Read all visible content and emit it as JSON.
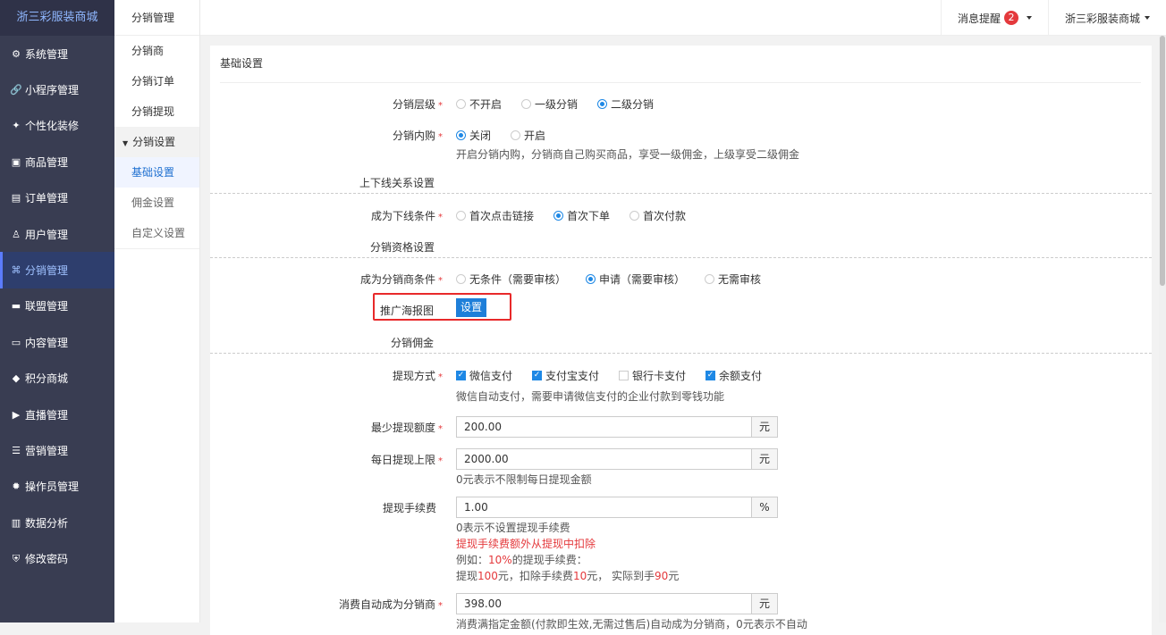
{
  "brand": "浙三彩服装商城",
  "sidebar": {
    "items": [
      {
        "label": "系统管理",
        "icon": "gear-icon"
      },
      {
        "label": "小程序管理",
        "icon": "link-icon"
      },
      {
        "label": "个性化装修",
        "icon": "brush-icon"
      },
      {
        "label": "商品管理",
        "icon": "bag-icon"
      },
      {
        "label": "订单管理",
        "icon": "clipboard-icon"
      },
      {
        "label": "用户管理",
        "icon": "user-icon"
      },
      {
        "label": "分销管理",
        "icon": "share-icon"
      },
      {
        "label": "联盟管理",
        "icon": "store-icon"
      },
      {
        "label": "内容管理",
        "icon": "content-icon"
      },
      {
        "label": "积分商城",
        "icon": "cube-icon"
      },
      {
        "label": "直播管理",
        "icon": "play-icon"
      },
      {
        "label": "营销管理",
        "icon": "marketing-icon"
      },
      {
        "label": "操作员管理",
        "icon": "cog-icon"
      },
      {
        "label": "数据分析",
        "icon": "chart-icon"
      },
      {
        "label": "修改密码",
        "icon": "shield-icon"
      }
    ],
    "active": "分销管理"
  },
  "submenu": {
    "title": "分销管理",
    "items": [
      "分销商",
      "分销订单",
      "分销提现"
    ],
    "group": "分销设置",
    "group_items": [
      "基础设置",
      "佣金设置",
      "自定义设置"
    ],
    "active": "基础设置"
  },
  "topbar": {
    "messages": "消息提醒",
    "badge": "2",
    "account": "浙三彩服装商城"
  },
  "panel": {
    "title": "基础设置"
  },
  "form": {
    "level": {
      "label": "分销层级",
      "options": [
        "不开启",
        "一级分销",
        "二级分销"
      ],
      "selected": "二级分销"
    },
    "inner": {
      "label": "分销内购",
      "options": [
        "关闭",
        "开启"
      ],
      "selected": "关闭",
      "hint": "开启分销内购，分销商自己购买商品，享受一级佣金，上级享受二级佣金"
    },
    "relation_section": "上下线关系设置",
    "downline": {
      "label": "成为下线条件",
      "options": [
        "首次点击链接",
        "首次下单",
        "首次付款"
      ],
      "selected": "首次下单"
    },
    "qual_section": "分销资格设置",
    "qual": {
      "label": "成为分销商条件",
      "options": [
        "无条件（需要审核）",
        "申请（需要审核）",
        "无需审核"
      ],
      "selected": "申请（需要审核）"
    },
    "poster": {
      "label": "推广海报图",
      "button": "设置"
    },
    "commission_section": "分销佣金",
    "withdraw": {
      "label": "提现方式",
      "options": [
        {
          "label": "微信支付",
          "checked": true
        },
        {
          "label": "支付宝支付",
          "checked": true
        },
        {
          "label": "银行卡支付",
          "checked": false
        },
        {
          "label": "余额支付",
          "checked": true
        }
      ],
      "hint": "微信自动支付，需要申请微信支付的企业付款到零钱功能"
    },
    "min_amount": {
      "label": "最少提现额度",
      "value": "200.00",
      "unit": "元"
    },
    "daily_limit": {
      "label": "每日提现上限",
      "value": "2000.00",
      "unit": "元",
      "hint": "0元表示不限制每日提现金额"
    },
    "fee": {
      "label": "提现手续费",
      "value": "1.00",
      "unit": "%",
      "hint": "0表示不设置提现手续费",
      "warn": "提现手续费额外从提现中扣除",
      "ex1a": "例如：",
      "ex1b": "10%",
      "ex1c": "的提现手续费：",
      "ex2a": "提现",
      "ex2b": "100",
      "ex2c": "元，扣除手续费",
      "ex2d": "10",
      "ex2e": "元， 实际到手",
      "ex2f": "90",
      "ex2g": "元"
    },
    "auto": {
      "label": "消费自动成为分销商",
      "value": "398.00",
      "unit": "元",
      "hint": "消费满指定金额(付款即生效,无需过售后)自动成为分销商，0元表示不自动"
    }
  }
}
